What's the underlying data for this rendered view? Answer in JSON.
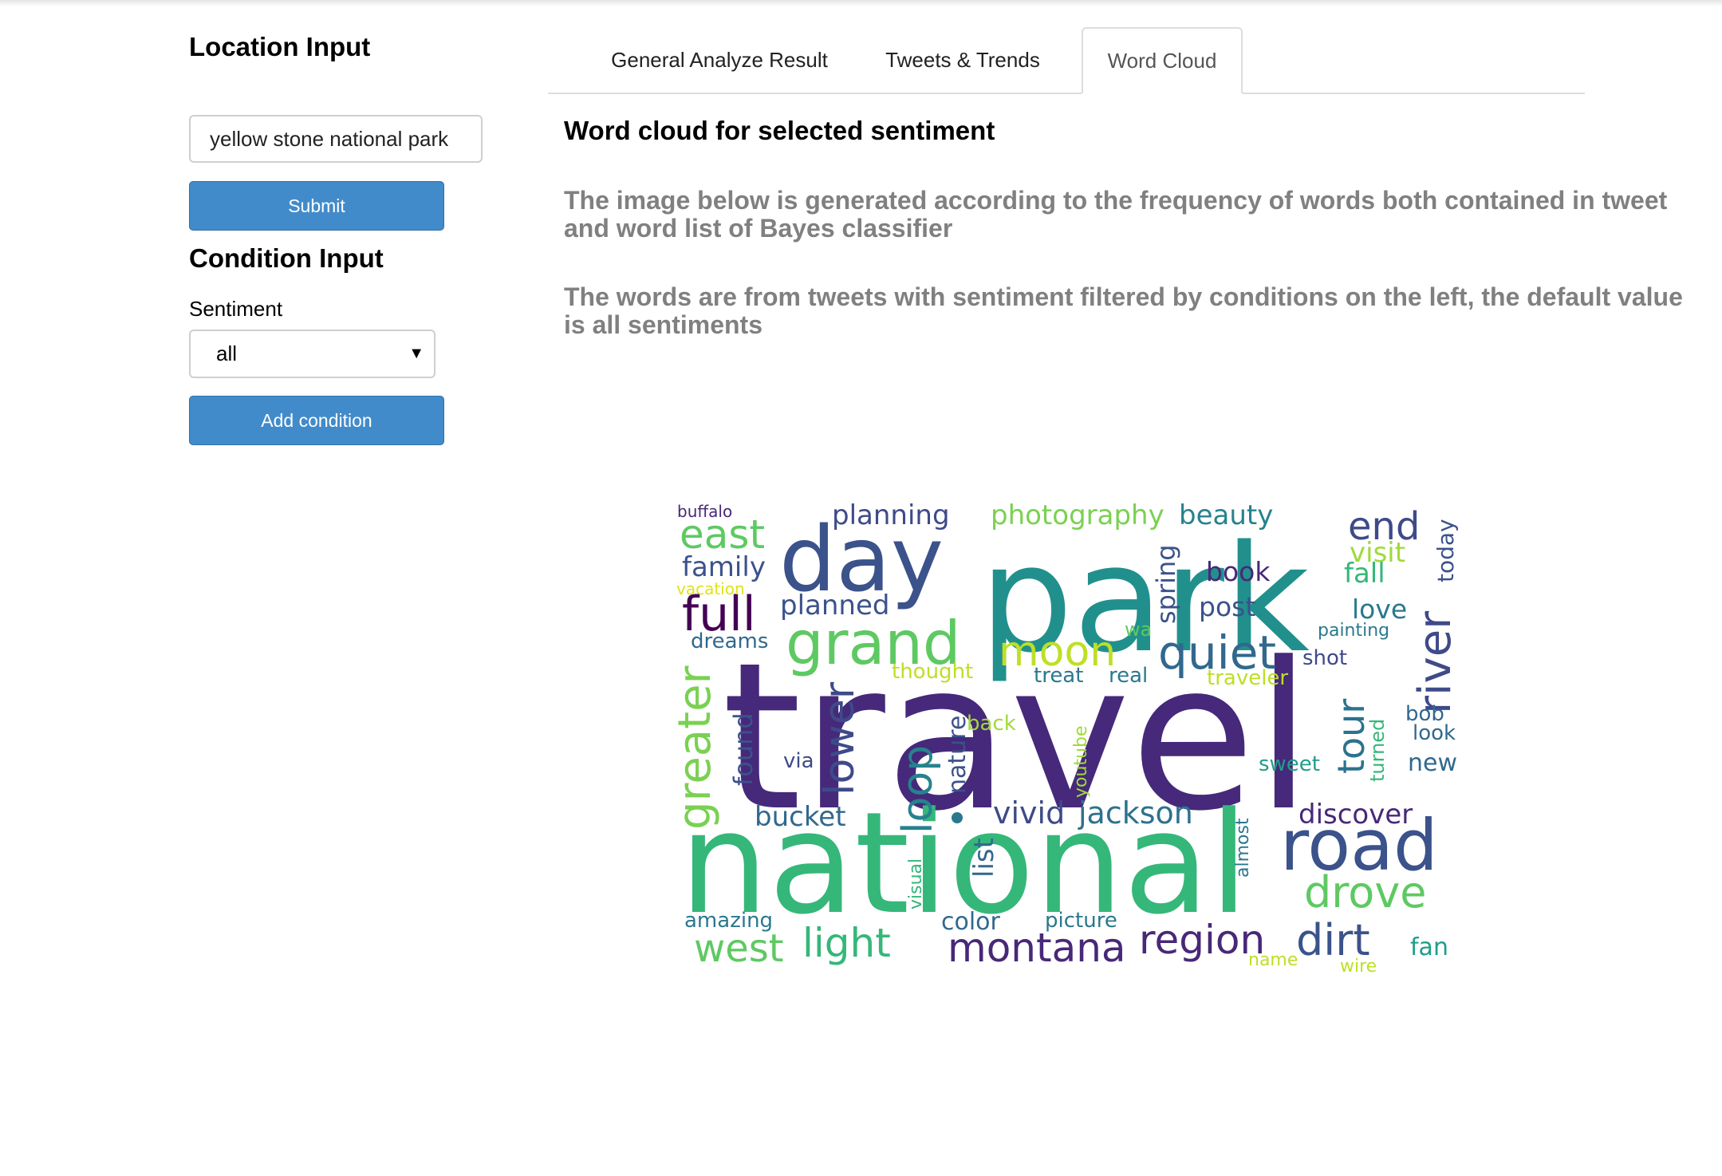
{
  "left_panel": {
    "location_heading": "Location Input",
    "location_value": "yellow stone national park",
    "submit_label": "Submit",
    "condition_heading": "Condition Input",
    "sentiment_label": "Sentiment",
    "sentiment_selected": "all",
    "add_condition_label": "Add condition"
  },
  "tabs": [
    {
      "label": "General Analyze Result",
      "active": false
    },
    {
      "label": "Tweets & Trends",
      "active": false
    },
    {
      "label": "Word Cloud",
      "active": true
    }
  ],
  "content": {
    "title": "Word cloud for selected sentiment",
    "description_1": "The image below is generated according to the frequency of words both contained in tweet and word list of Bayes classifier",
    "description_2": "The words are from tweets with sentiment filtered by conditions on the left, the default value is all sentiments"
  },
  "word_cloud": {
    "palette": "viridis",
    "words": [
      "travel",
      "national",
      "park",
      "day",
      "road",
      "grand",
      "river",
      "greater",
      "quiet",
      "moon",
      "full",
      "lower",
      "loop",
      "tour",
      "drove",
      "dirt",
      "region",
      "montana",
      "light",
      "west",
      "east",
      "end",
      "planning",
      "photography",
      "beauty",
      "family",
      "planned",
      "visit",
      "fall",
      "book",
      "post",
      "love",
      "today",
      "spring",
      "jackson",
      "vivid",
      "discover",
      "bucket",
      "list",
      "nature",
      "found",
      "via",
      "back",
      "youtube",
      "sweet",
      "new",
      "look",
      "bob",
      "turned",
      "shot",
      "traveler",
      "real",
      "treat",
      "thought",
      "painting",
      "dreams",
      "vacation",
      "buffalo",
      "almost",
      "visual",
      "color",
      "picture",
      "amazing",
      "name",
      "wire",
      "fan",
      "wa"
    ]
  }
}
